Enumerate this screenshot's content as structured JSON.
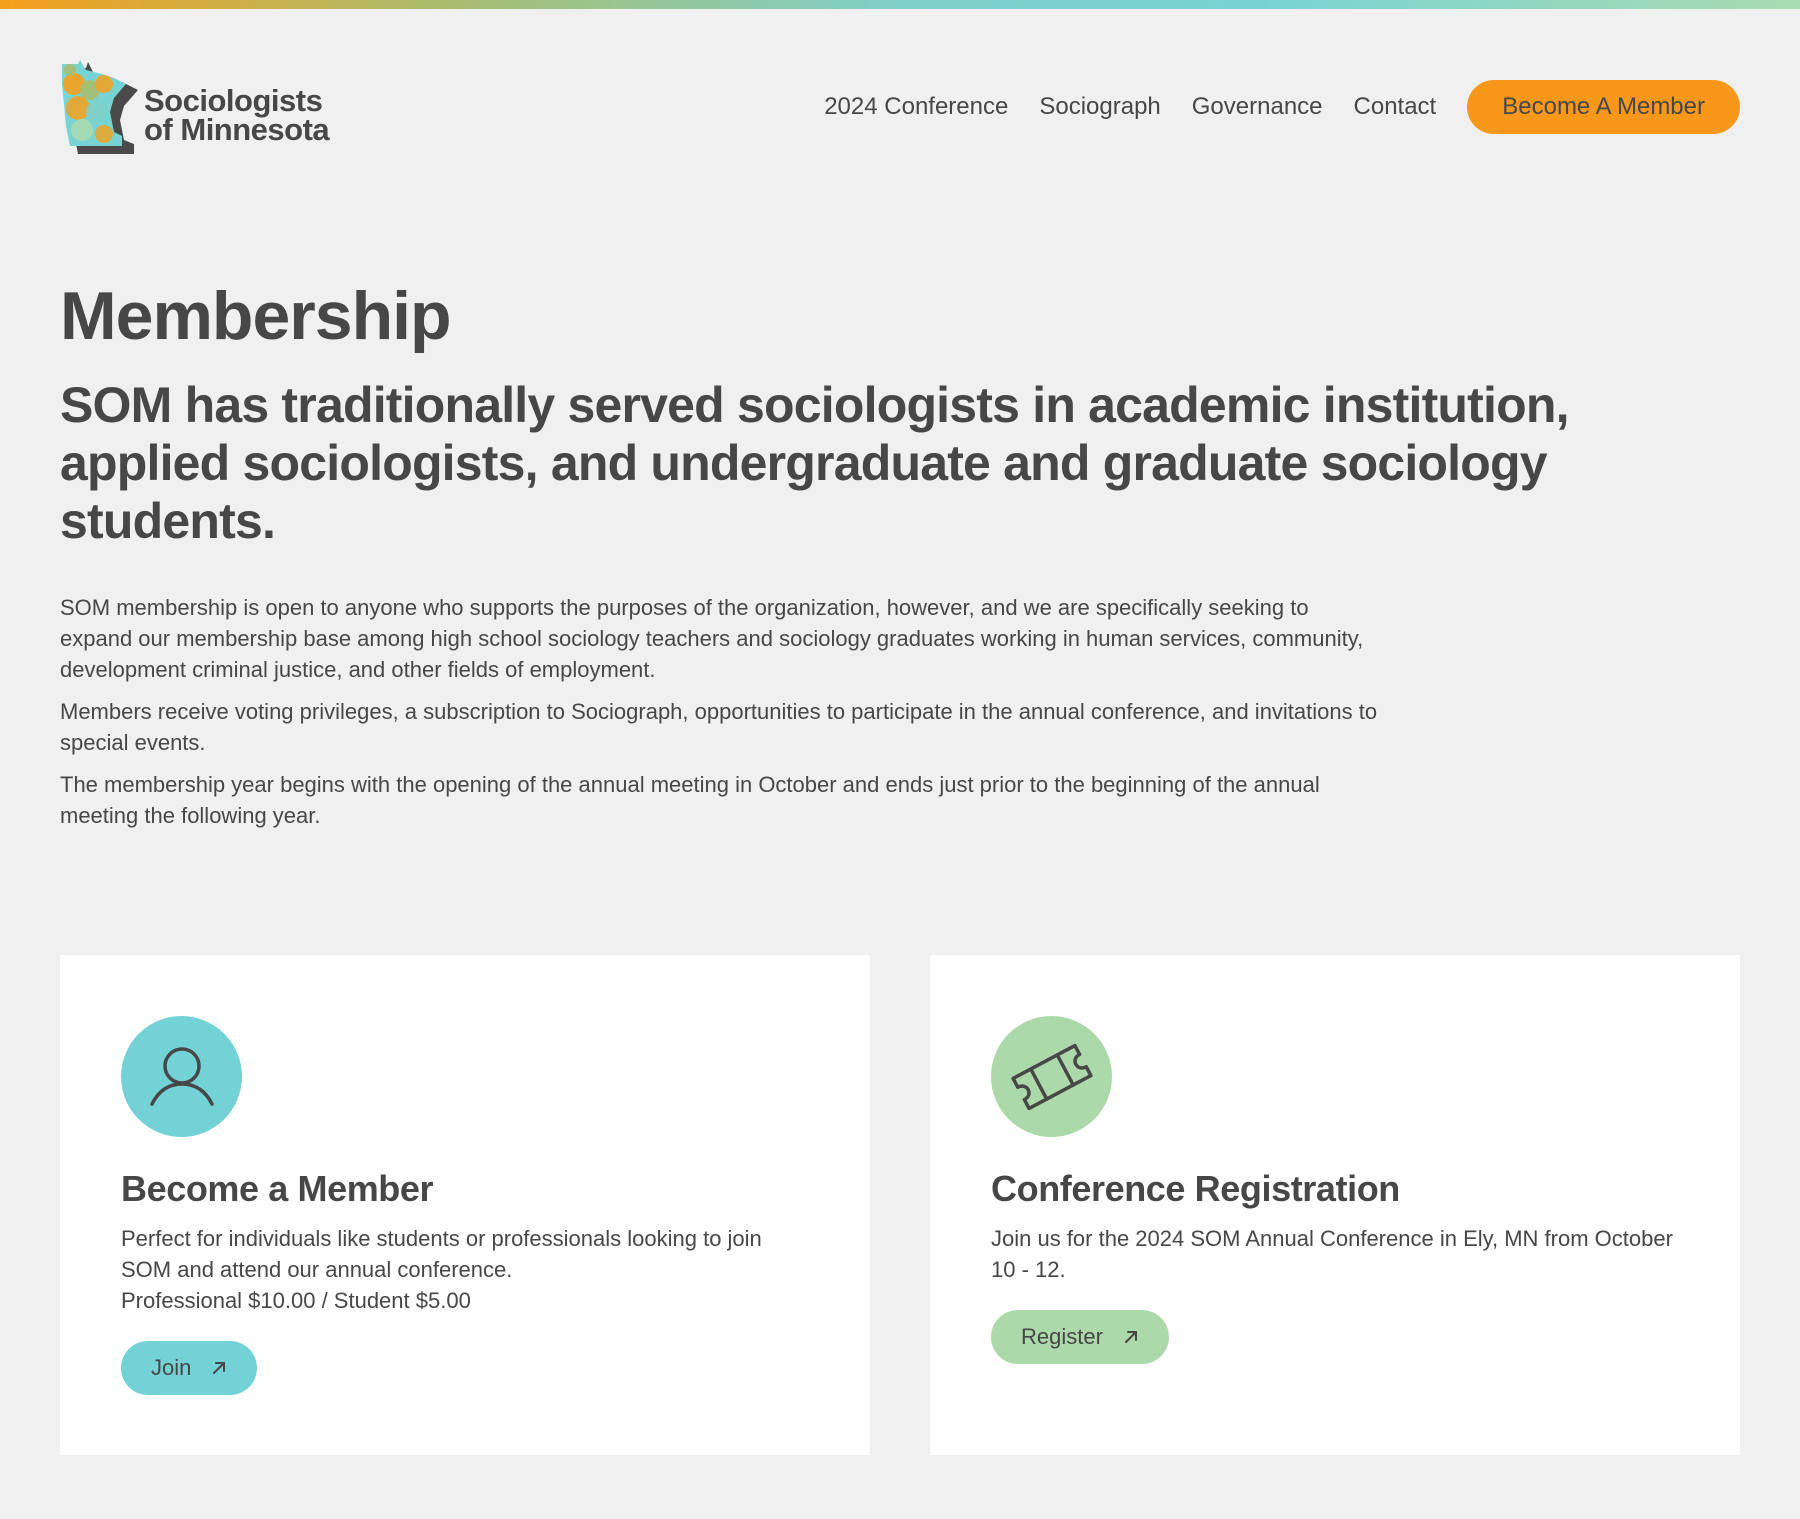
{
  "brand": {
    "name_line1": "Sociologists",
    "name_line2": "of Minnesota",
    "logo_icon": "minnesota-map-logo-icon",
    "colors": {
      "orange": "#f7981b",
      "teal": "#72d2d6",
      "green": "#acd9a9",
      "text": "#474747",
      "background": "#f0f0f0"
    }
  },
  "nav": {
    "items": [
      {
        "label": "2024 Conference"
      },
      {
        "label": "Sociograph"
      },
      {
        "label": "Governance"
      },
      {
        "label": "Contact"
      }
    ],
    "cta_label": "Become A Member"
  },
  "main": {
    "title": "Membership",
    "lead": "SOM has traditionally served sociologists in academic institution, applied sociologists, and undergraduate and graduate sociology students.",
    "paragraphs": [
      "SOM membership is open to anyone who supports the purposes of the organization, however, and we are specifically seeking to expand our membership base among high school sociology teachers and sociology graduates working in human services, community, development criminal justice, and other fields of employment.",
      "Members receive voting privileges, a subscription to Sociograph, opportunities to participate in the annual conference, and invitations to special events.",
      "The membership year begins with the opening of the annual meeting in October and ends just prior to the beginning of the annual meeting the following year."
    ]
  },
  "cards": [
    {
      "icon": "user-icon",
      "title": "Become a Member",
      "description": "Perfect for individuals like students or professionals looking to join SOM and attend our annual conference.",
      "price": "Professional $10.00 / Student $5.00",
      "button_label": "Join",
      "button_icon": "arrow-up-right-icon"
    },
    {
      "icon": "ticket-icon",
      "title": "Conference Registration",
      "description": "Join us for the 2024 SOM Annual Conference in Ely, MN from October 10 - 12.",
      "button_label": "Register",
      "button_icon": "arrow-up-right-icon"
    }
  ]
}
